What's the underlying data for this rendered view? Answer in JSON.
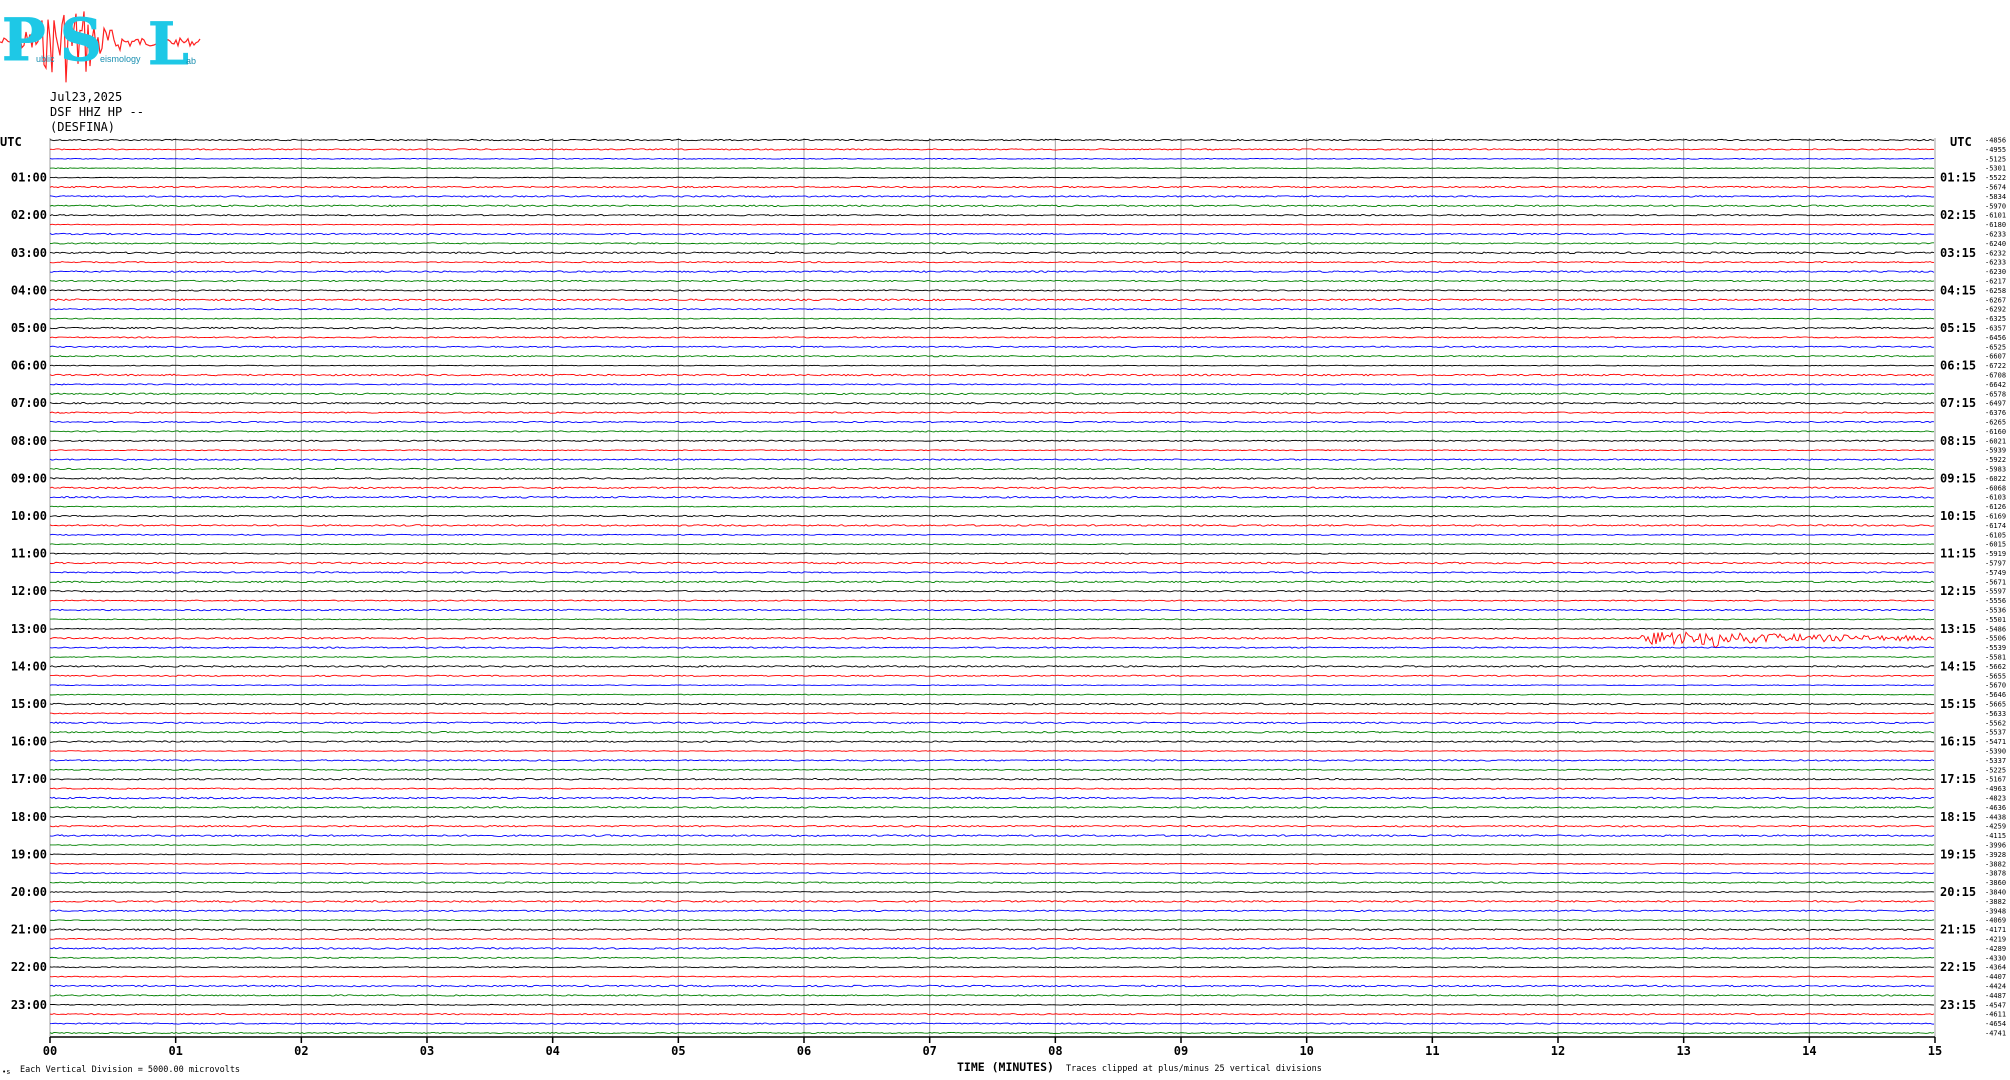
{
  "logo": {
    "letters": "PSL",
    "word_1": "ublic",
    "word_2": "eismology",
    "word_3": "ab",
    "colors": {
      "text": "#1ec8e6",
      "trace": "#ff2020"
    }
  },
  "header": {
    "date": "Jul23,2025",
    "station": "DSF HHZ HP --",
    "site": "(DESFINA)"
  },
  "utc_left": "UTC",
  "utc_right": "UTC",
  "footer": {
    "xlabel": "TIME (MINUTES)",
    "scale_note": "Each Vertical Division = 5000.00 microvolts",
    "clip_note": "Traces clipped at plus/minus 25 vertical divisions",
    "corner_mark": "•s"
  },
  "colors": {
    "grid": "#a0a0a0",
    "axis": "#000000",
    "trace_cycle": [
      "#000000",
      "#ff0000",
      "#0000ff",
      "#008000"
    ]
  },
  "chart_data": {
    "type": "helicorder",
    "x": {
      "range": [
        0,
        15
      ],
      "tick_labels": [
        "00",
        "01",
        "02",
        "03",
        "04",
        "05",
        "06",
        "07",
        "08",
        "09",
        "10",
        "11",
        "12",
        "13",
        "14",
        "15"
      ]
    },
    "left_hour_labels": [
      "01:00",
      "02:00",
      "03:00",
      "04:00",
      "05:00",
      "06:00",
      "07:00",
      "08:00",
      "09:00",
      "10:00",
      "11:00",
      "12:00",
      "13:00",
      "14:00",
      "15:00",
      "16:00",
      "17:00",
      "18:00",
      "19:00",
      "20:00",
      "21:00",
      "22:00",
      "23:00"
    ],
    "right_hour_labels": [
      "01:15",
      "02:15",
      "03:15",
      "04:15",
      "05:15",
      "06:15",
      "07:15",
      "08:15",
      "09:15",
      "10:15",
      "11:15",
      "12:15",
      "13:15",
      "14:15",
      "15:15",
      "16:15",
      "17:15",
      "18:15",
      "19:15",
      "20:15",
      "21:15",
      "22:15",
      "23:15"
    ],
    "offset_labels": [
      "-4856",
      "-4955",
      "-5125",
      "-5301",
      "-5522",
      "-5674",
      "-5834",
      "-5970",
      "-6101",
      "-6180",
      "-6233",
      "-6240",
      "-6232",
      "-6233",
      "-6230",
      "-6217",
      "-6258",
      "-6267",
      "-6292",
      "-6325",
      "-6357",
      "-6456",
      "-6525",
      "-6607",
      "-6722",
      "-6708",
      "-6642",
      "-6578",
      "-6497",
      "-6376",
      "-6265",
      "-6160",
      "-6021",
      "-5939",
      "-5922",
      "-5983",
      "-6022",
      "-6068",
      "-6103",
      "-6126",
      "-6169",
      "-6174",
      "-6105",
      "-6015",
      "-5919",
      "-5797",
      "-5749",
      "-5671",
      "-5597",
      "-5556",
      "-5536",
      "-5501",
      "-5486",
      "-5506",
      "-5539",
      "-5581",
      "-5662",
      "-5655",
      "-5670",
      "-5646",
      "-5665",
      "-5633",
      "-5562",
      "-5537",
      "-5471",
      "-5390",
      "-5337",
      "-5225",
      "-5167",
      "-4963",
      "-4823",
      "-4636",
      "-4438",
      "-4259",
      "-4115",
      "-3996",
      "-3928",
      "-3882",
      "-3878",
      "-3860",
      "-3840",
      "-3882",
      "-3948",
      "-4069",
      "-4171",
      "-4219",
      "-4289",
      "-4330",
      "-4364",
      "-4407",
      "-4424",
      "-4487",
      "-4547",
      "-4611",
      "-4654",
      "-4741"
    ],
    "events": [
      {
        "trace": 53,
        "start_min": 12.6,
        "peak_min": 13.25,
        "end_min": 15.0,
        "amplitude_divisions": 1.2
      }
    ]
  }
}
